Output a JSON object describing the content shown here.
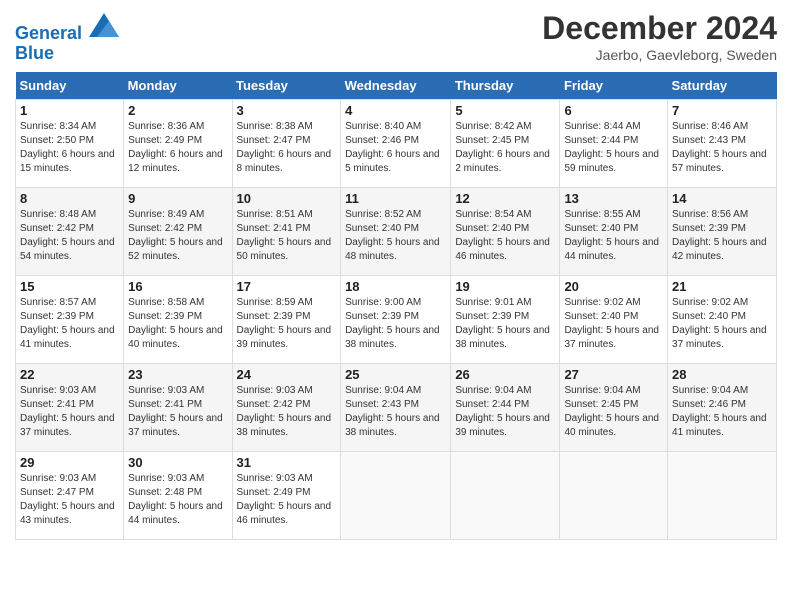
{
  "header": {
    "logo_line1": "General",
    "logo_line2": "Blue",
    "month_title": "December 2024",
    "location": "Jaerbo, Gaevleborg, Sweden"
  },
  "days_of_week": [
    "Sunday",
    "Monday",
    "Tuesday",
    "Wednesday",
    "Thursday",
    "Friday",
    "Saturday"
  ],
  "weeks": [
    [
      {
        "day": "1",
        "sunrise": "8:34 AM",
        "sunset": "2:50 PM",
        "daylight": "6 hours and 15 minutes."
      },
      {
        "day": "2",
        "sunrise": "8:36 AM",
        "sunset": "2:49 PM",
        "daylight": "6 hours and 12 minutes."
      },
      {
        "day": "3",
        "sunrise": "8:38 AM",
        "sunset": "2:47 PM",
        "daylight": "6 hours and 8 minutes."
      },
      {
        "day": "4",
        "sunrise": "8:40 AM",
        "sunset": "2:46 PM",
        "daylight": "6 hours and 5 minutes."
      },
      {
        "day": "5",
        "sunrise": "8:42 AM",
        "sunset": "2:45 PM",
        "daylight": "6 hours and 2 minutes."
      },
      {
        "day": "6",
        "sunrise": "8:44 AM",
        "sunset": "2:44 PM",
        "daylight": "5 hours and 59 minutes."
      },
      {
        "day": "7",
        "sunrise": "8:46 AM",
        "sunset": "2:43 PM",
        "daylight": "5 hours and 57 minutes."
      }
    ],
    [
      {
        "day": "8",
        "sunrise": "8:48 AM",
        "sunset": "2:42 PM",
        "daylight": "5 hours and 54 minutes."
      },
      {
        "day": "9",
        "sunrise": "8:49 AM",
        "sunset": "2:42 PM",
        "daylight": "5 hours and 52 minutes."
      },
      {
        "day": "10",
        "sunrise": "8:51 AM",
        "sunset": "2:41 PM",
        "daylight": "5 hours and 50 minutes."
      },
      {
        "day": "11",
        "sunrise": "8:52 AM",
        "sunset": "2:40 PM",
        "daylight": "5 hours and 48 minutes."
      },
      {
        "day": "12",
        "sunrise": "8:54 AM",
        "sunset": "2:40 PM",
        "daylight": "5 hours and 46 minutes."
      },
      {
        "day": "13",
        "sunrise": "8:55 AM",
        "sunset": "2:40 PM",
        "daylight": "5 hours and 44 minutes."
      },
      {
        "day": "14",
        "sunrise": "8:56 AM",
        "sunset": "2:39 PM",
        "daylight": "5 hours and 42 minutes."
      }
    ],
    [
      {
        "day": "15",
        "sunrise": "8:57 AM",
        "sunset": "2:39 PM",
        "daylight": "5 hours and 41 minutes."
      },
      {
        "day": "16",
        "sunrise": "8:58 AM",
        "sunset": "2:39 PM",
        "daylight": "5 hours and 40 minutes."
      },
      {
        "day": "17",
        "sunrise": "8:59 AM",
        "sunset": "2:39 PM",
        "daylight": "5 hours and 39 minutes."
      },
      {
        "day": "18",
        "sunrise": "9:00 AM",
        "sunset": "2:39 PM",
        "daylight": "5 hours and 38 minutes."
      },
      {
        "day": "19",
        "sunrise": "9:01 AM",
        "sunset": "2:39 PM",
        "daylight": "5 hours and 38 minutes."
      },
      {
        "day": "20",
        "sunrise": "9:02 AM",
        "sunset": "2:40 PM",
        "daylight": "5 hours and 37 minutes."
      },
      {
        "day": "21",
        "sunrise": "9:02 AM",
        "sunset": "2:40 PM",
        "daylight": "5 hours and 37 minutes."
      }
    ],
    [
      {
        "day": "22",
        "sunrise": "9:03 AM",
        "sunset": "2:41 PM",
        "daylight": "5 hours and 37 minutes."
      },
      {
        "day": "23",
        "sunrise": "9:03 AM",
        "sunset": "2:41 PM",
        "daylight": "5 hours and 37 minutes."
      },
      {
        "day": "24",
        "sunrise": "9:03 AM",
        "sunset": "2:42 PM",
        "daylight": "5 hours and 38 minutes."
      },
      {
        "day": "25",
        "sunrise": "9:04 AM",
        "sunset": "2:43 PM",
        "daylight": "5 hours and 38 minutes."
      },
      {
        "day": "26",
        "sunrise": "9:04 AM",
        "sunset": "2:44 PM",
        "daylight": "5 hours and 39 minutes."
      },
      {
        "day": "27",
        "sunrise": "9:04 AM",
        "sunset": "2:45 PM",
        "daylight": "5 hours and 40 minutes."
      },
      {
        "day": "28",
        "sunrise": "9:04 AM",
        "sunset": "2:46 PM",
        "daylight": "5 hours and 41 minutes."
      }
    ],
    [
      {
        "day": "29",
        "sunrise": "9:03 AM",
        "sunset": "2:47 PM",
        "daylight": "5 hours and 43 minutes."
      },
      {
        "day": "30",
        "sunrise": "9:03 AM",
        "sunset": "2:48 PM",
        "daylight": "5 hours and 44 minutes."
      },
      {
        "day": "31",
        "sunrise": "9:03 AM",
        "sunset": "2:49 PM",
        "daylight": "5 hours and 46 minutes."
      },
      {
        "day": "",
        "sunrise": "",
        "sunset": "",
        "daylight": ""
      },
      {
        "day": "",
        "sunrise": "",
        "sunset": "",
        "daylight": ""
      },
      {
        "day": "",
        "sunrise": "",
        "sunset": "",
        "daylight": ""
      },
      {
        "day": "",
        "sunrise": "",
        "sunset": "",
        "daylight": ""
      }
    ]
  ],
  "labels": {
    "sunrise_prefix": "Sunrise: ",
    "sunset_prefix": "Sunset: ",
    "daylight_prefix": "Daylight: "
  }
}
